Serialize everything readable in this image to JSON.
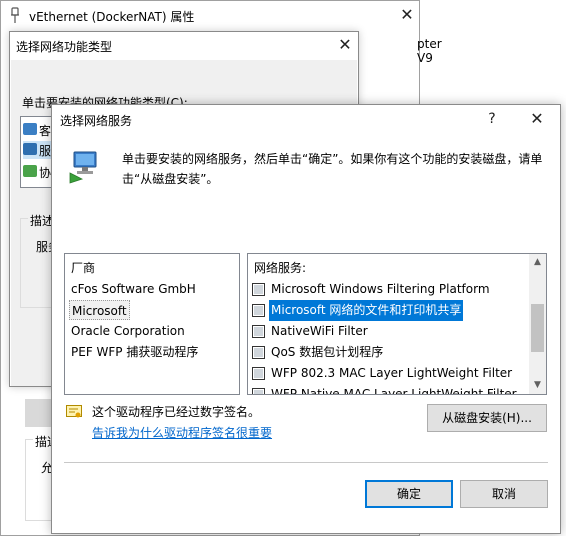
{
  "bg_window": {
    "title": "vEthernet (DockerNAT) 属性",
    "adapter_fragment": "pter V9",
    "desc_label": "描述",
    "desc_text": "允"
  },
  "select_type_dialog": {
    "title": "选择网络功能类型",
    "prompt": "单击要安装的网络功能类型(C):",
    "items": [
      "客",
      "服",
      "协"
    ],
    "desc_label": "描述",
    "desc_text": "服务"
  },
  "service_dialog": {
    "title": "选择网络服务",
    "help_glyph": "?",
    "instruction": "单击要安装的网络服务，然后单击“确定”。如果你有这个功能的安装磁盘，请单击“从磁盘安装”。",
    "manufacturers": {
      "header": "厂商",
      "items": [
        "cFos Software GmbH",
        "Microsoft",
        "Oracle Corporation",
        "PEF WFP 捕获驱动程序"
      ],
      "selected_index": 1
    },
    "services": {
      "header": "网络服务:",
      "items": [
        "Microsoft Windows Filtering Platform",
        "Microsoft 网络的文件和打印机共享",
        "NativeWiFi Filter",
        "QoS 数据包计划程序",
        "WFP 802.3 MAC Layer LightWeight Filter",
        "WFP Native MAC Layer LightWeight Filter"
      ],
      "selected_index": 1
    },
    "signed_text": "这个驱动程序已经过数字签名。",
    "signing_link": "告诉我为什么驱动程序签名很重要",
    "have_disk_button": "从磁盘安装(H)...",
    "ok_button": "确定",
    "cancel_button": "取消"
  },
  "colors": {
    "accent": "#0078d7",
    "link": "#0066cc",
    "button_face": "#e1e1e1",
    "footer_bg": "#f0f0f0"
  },
  "icons": [
    "pin-icon",
    "close-icon",
    "help-icon",
    "network-service-icon",
    "certificate-icon",
    "network-adapter-icon",
    "scroll-up-icon",
    "scroll-down-icon"
  ]
}
